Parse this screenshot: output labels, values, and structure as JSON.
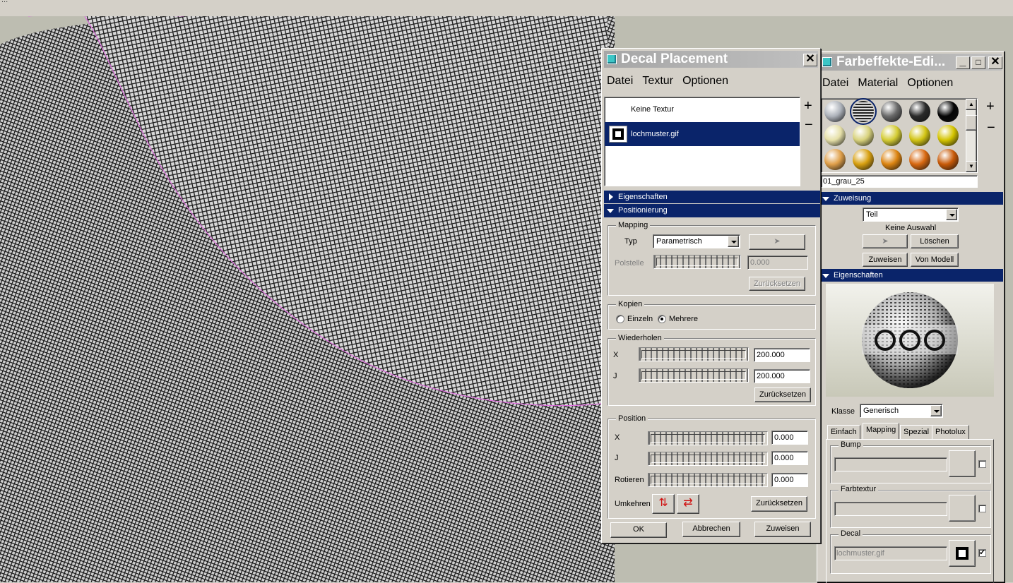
{
  "viewport": {
    "top_text": "..."
  },
  "decal": {
    "title": "Decal Placement",
    "menu": [
      "Datei",
      "Textur",
      "Optionen"
    ],
    "list": [
      {
        "label": "Keine Textur",
        "selected": false
      },
      {
        "label": "lochmuster.gif",
        "selected": true
      }
    ],
    "add_symbol": "+",
    "remove_symbol": "−",
    "sections": {
      "properties": "Eigenschaften",
      "positioning": "Positionierung"
    },
    "mapping": {
      "group": "Mapping",
      "type_label": "Typ",
      "type_value": "Parametrisch",
      "pole_label": "Polstelle",
      "pole_value": "0.000",
      "reset": "Zurücksetzen"
    },
    "copies": {
      "group": "Kopien",
      "single": "Einzeln",
      "multiple": "Mehrere",
      "selected": "Mehrere"
    },
    "repeat": {
      "group": "Wiederholen",
      "x_label": "X",
      "x_value": "200.000",
      "j_label": "J",
      "j_value": "200.000",
      "reset": "Zurücksetzen"
    },
    "position": {
      "group": "Position",
      "x_label": "X",
      "x_value": "0.000",
      "j_label": "J",
      "j_value": "0.000",
      "rotate_label": "Rotieren",
      "rotate_value": "0.000",
      "flip_label": "Umkehren",
      "reset": "Zurücksetzen"
    },
    "buttons": {
      "ok": "OK",
      "cancel": "Abbrechen",
      "assign": "Zuweisen"
    }
  },
  "farb": {
    "title": "Farbeffekte-Edi...",
    "menu": [
      "Datei",
      "Material",
      "Optionen"
    ],
    "swatches": [
      "#aeb3bb",
      "#8f8f8f",
      "#6a6a6a",
      "#2a2a2a",
      "#050505",
      "#e6e0a8",
      "#d8d27c",
      "#d4cc34",
      "#d2c414",
      "#d4c400",
      "#e0a04a",
      "#d8a010",
      "#dc8410",
      "#d86810",
      "#c85a08"
    ],
    "material_name": "01_grau_25",
    "assignment": {
      "header": "Zuweisung",
      "dropdown": "Teil",
      "status": "Keine Auswahl",
      "delete": "Löschen",
      "assign": "Zuweisen",
      "from_model": "Von Modell"
    },
    "properties_header": "Eigenschaften",
    "class_label": "Klasse",
    "class_value": "Generisch",
    "tabs": [
      "Einfach",
      "Mapping",
      "Spezial",
      "Photolux"
    ],
    "active_tab": "Mapping",
    "bump": "Bump",
    "color_texture": "Farbtextur",
    "decal_label": "Decal",
    "decal_file": "lochmuster.gif",
    "decal_checked": true
  }
}
